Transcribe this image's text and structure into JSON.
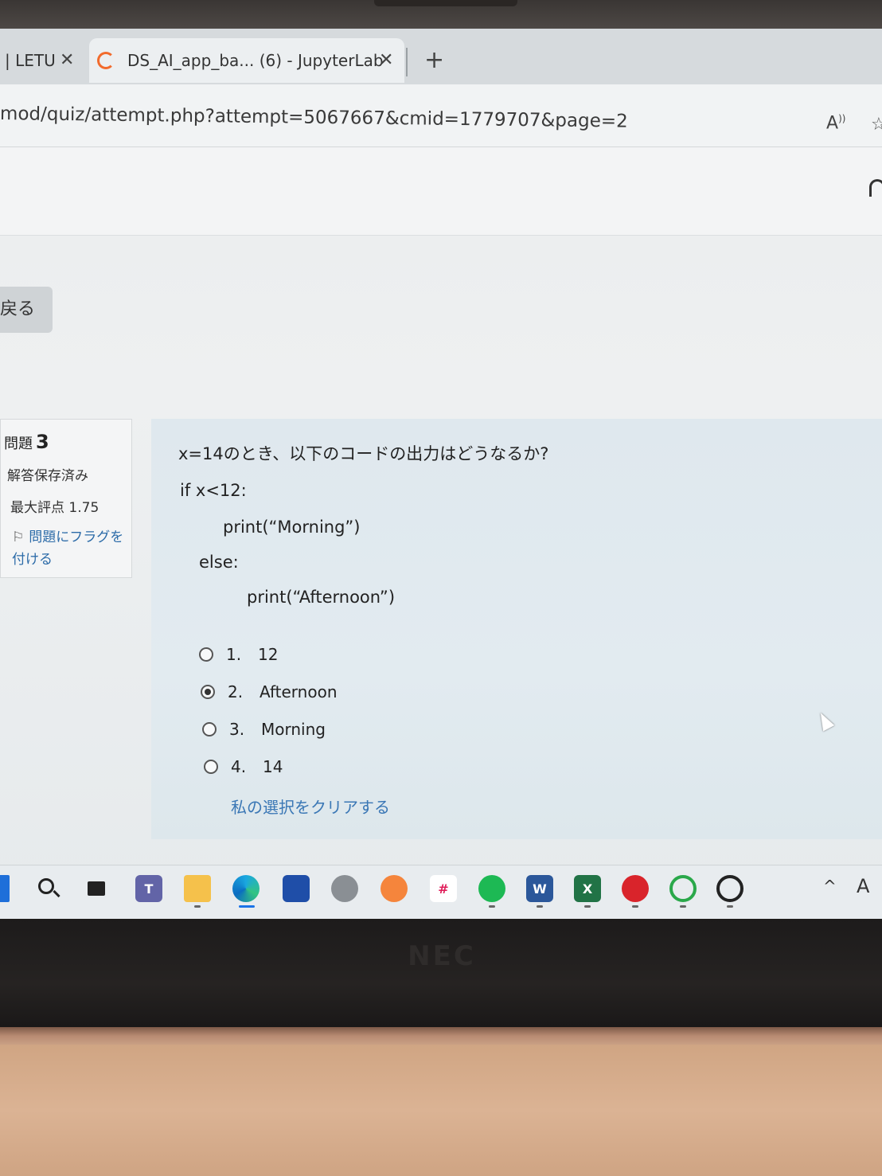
{
  "browser": {
    "tabs": [
      {
        "title": "| LETU",
        "close": "✕"
      },
      {
        "title": "DS_AI_app_ba... (6) - JupyterLab",
        "close": "✕"
      }
    ],
    "new_tab": "+",
    "url": "mod/quiz/attempt.php?attempt=5067667&cmid=1779707&page=2",
    "read_aloud": "A",
    "read_aloud_icon": "read-aloud-icon",
    "favorite_icon": "star-icon"
  },
  "page": {
    "back_button": "戻る"
  },
  "question_info": {
    "label": "問題",
    "number": "3",
    "state": "解答保存済み",
    "max_grade": "最大評点 1.75",
    "flag_link": "問題にフラグを付ける",
    "flag_icon": "flag-icon"
  },
  "question": {
    "text": "x=14のとき、以下のコードの出力はどうなるか?",
    "code_lines": [
      "if x<12:",
      "print(“Morning”)",
      "else:",
      "print(“Afternoon”)"
    ],
    "answers": [
      {
        "number": "1.",
        "label": "12",
        "selected": false
      },
      {
        "number": "2.",
        "label": "Afternoon",
        "selected": true
      },
      {
        "number": "3.",
        "label": "Morning",
        "selected": false
      },
      {
        "number": "4.",
        "label": "14",
        "selected": false
      }
    ],
    "clear_choice": "私の選択をクリアする"
  },
  "taskbar": {
    "icons": [
      "start-icon",
      "search-icon",
      "task-view-icon",
      "teams-icon",
      "file-explorer-icon",
      "edge-icon",
      "store-icon",
      "settings-icon",
      "clock-app-icon",
      "slack-icon",
      "spotify-icon",
      "word-icon",
      "excel-icon",
      "acrobat-icon",
      "ring-app-icon",
      "cloud-app-icon"
    ],
    "teams_label": "T",
    "word_label": "W",
    "excel_label": "X",
    "tray_chevron": "^",
    "ime_indicator": "A"
  },
  "device": {
    "logo": "NEC"
  }
}
